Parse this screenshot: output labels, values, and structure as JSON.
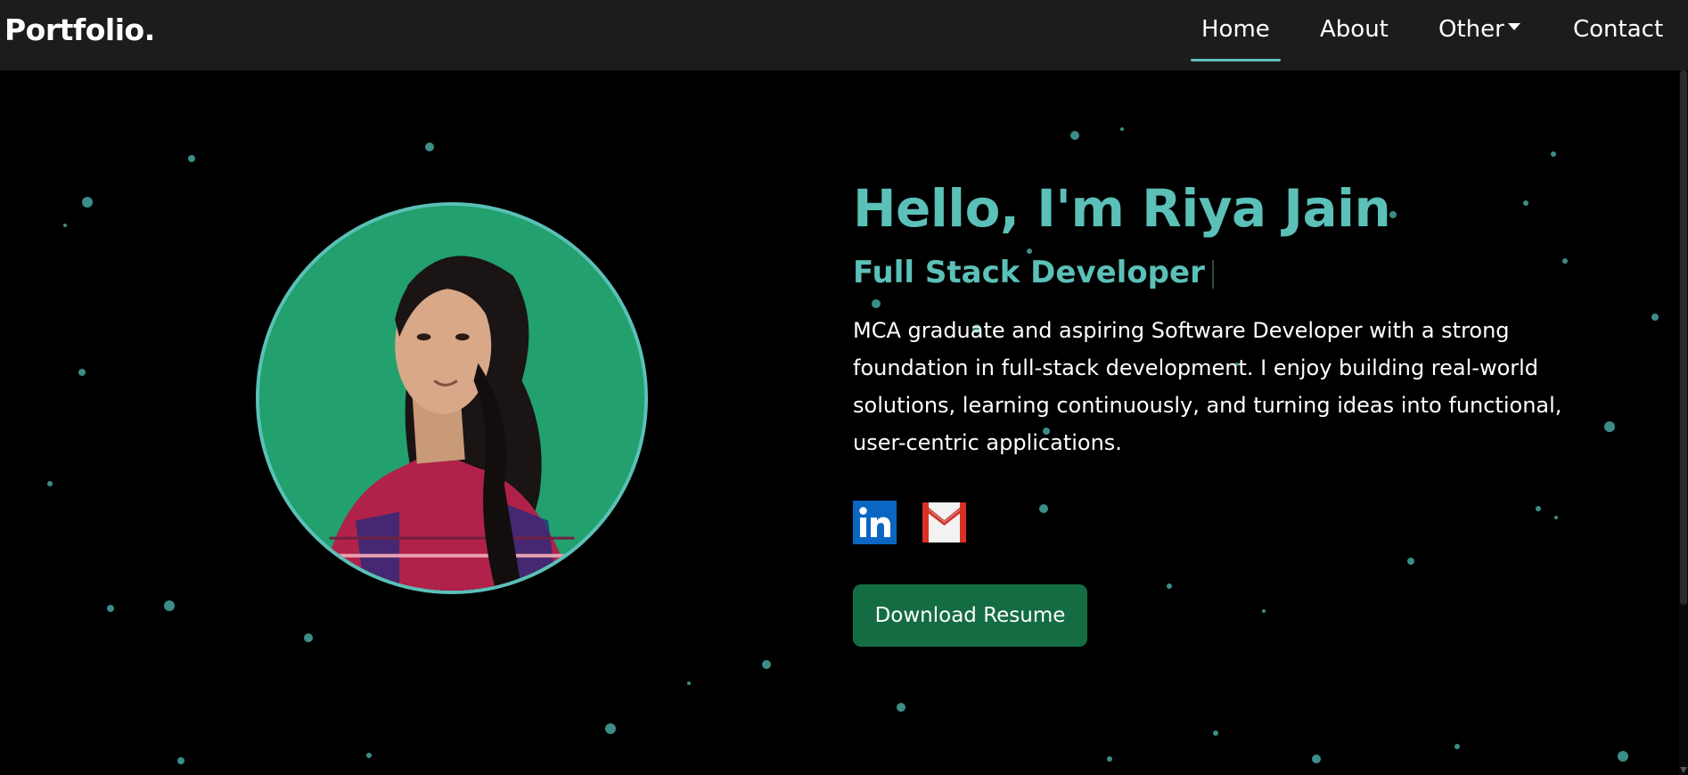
{
  "navbar": {
    "brand": "Portfolio.",
    "items": [
      {
        "label": "Home",
        "active": true
      },
      {
        "label": "About"
      },
      {
        "label": "Other",
        "dropdown": true
      },
      {
        "label": "Contact"
      }
    ]
  },
  "hero": {
    "greeting": "Hello, I'm Riya Jain",
    "role": "Full Stack Developer",
    "bio": "MCA graduate and aspiring Software Developer with a strong foundation in full-stack development. I enjoy building real-world solutions, learning continuously, and turning ideas into functional, user-centric applications.",
    "resume_label": "Download Resume",
    "social": [
      {
        "name": "linkedin-icon"
      },
      {
        "name": "gmail-icon"
      }
    ]
  },
  "colors": {
    "accent": "#5bc0b8",
    "navbar_bg": "#1c1c1c",
    "page_bg": "#000000",
    "button_bg": "#146c43",
    "avatar_bg": "#22a06e",
    "particle": "#3b8d88"
  }
}
